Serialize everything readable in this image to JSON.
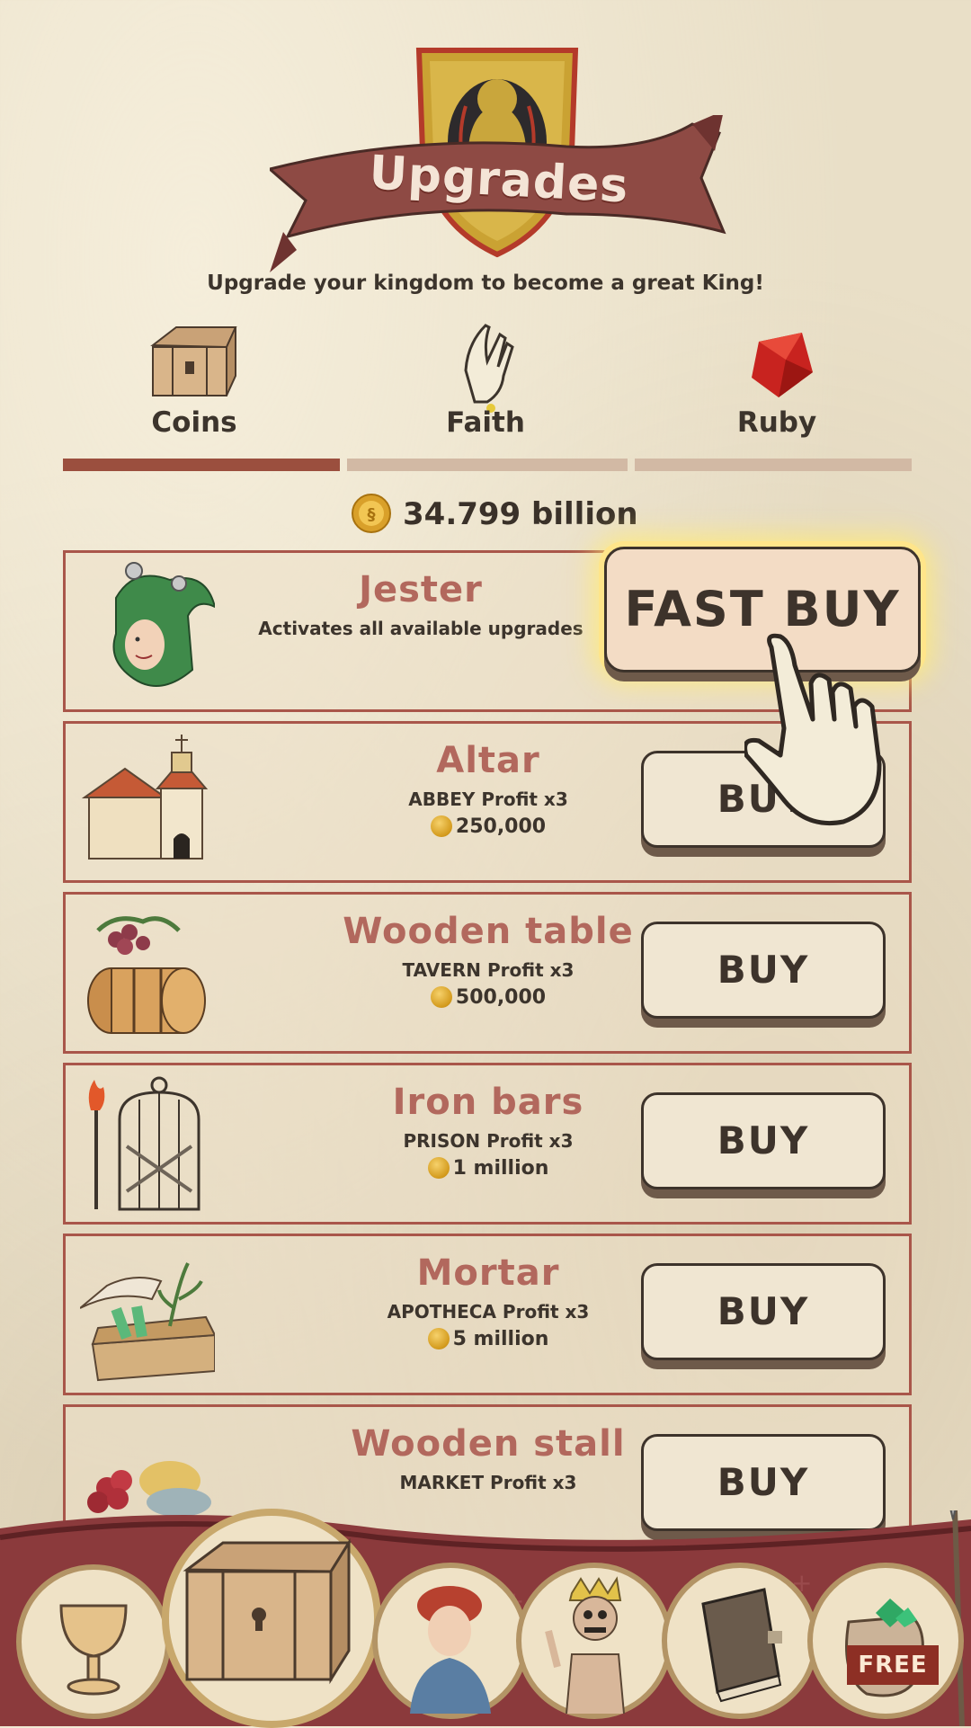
{
  "header": {
    "title": "Upgrades",
    "subtitle": "Upgrade your kingdom to become a great King!"
  },
  "tabs": [
    {
      "label": "Coins",
      "icon": "chest-icon",
      "active": true
    },
    {
      "label": "Faith",
      "icon": "praying-hands-icon",
      "active": false
    },
    {
      "label": "Ruby",
      "icon": "ruby-icon",
      "active": false
    }
  ],
  "balance": {
    "amount": "34.799 billion",
    "icon": "gold-coin-icon"
  },
  "jester": {
    "title": "Jester",
    "description": "Activates all available upgrades",
    "button": "FAST BUY"
  },
  "upgrades": [
    {
      "title": "Altar",
      "desc": "ABBEY Profit x3",
      "price": "250,000",
      "button": "BUY",
      "icon": "chapel-icon"
    },
    {
      "title": "Wooden table",
      "desc": "TAVERN Profit x3",
      "price": "500,000",
      "button": "BUY",
      "icon": "wine-barrels-icon"
    },
    {
      "title": "Iron bars",
      "desc": "PRISON Profit x3",
      "price": "1 million",
      "button": "BUY",
      "icon": "iron-cage-icon"
    },
    {
      "title": "Mortar",
      "desc": "APOTHECA Profit x3",
      "price": "5 million",
      "button": "BUY",
      "icon": "herb-crate-icon"
    },
    {
      "title": "Wooden stall",
      "desc": "MARKET Profit x3",
      "price": "",
      "button": "BUY",
      "icon": "produce-stall-icon"
    }
  ],
  "bottom_nav": {
    "items": [
      "goblet-icon",
      "treasure-chest-icon",
      "noble-portrait-icon",
      "skeleton-king-icon",
      "book-icon",
      "gem-sack-icon"
    ],
    "free_label": "FREE"
  },
  "colors": {
    "accent": "#9b4f3e",
    "title_text": "#b2685d",
    "parchment": "#e9dfc7"
  }
}
